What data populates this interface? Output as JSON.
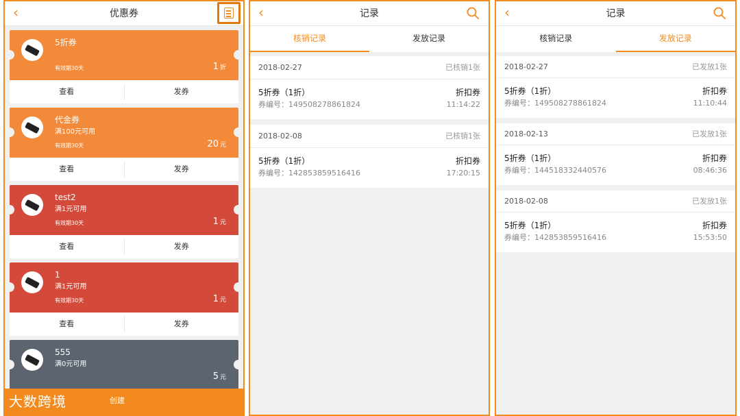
{
  "panel1": {
    "title": "优惠券",
    "back_icon": "‹",
    "coupons": [
      {
        "name": "5折券",
        "condition": "",
        "validity": "有效期30天",
        "amount": "1",
        "unit": "折",
        "color": "#f28a3a"
      },
      {
        "name": "代金券",
        "condition": "满100元可用",
        "validity": "有效期30天",
        "amount": "20",
        "unit": "元",
        "color": "#f28a3a"
      },
      {
        "name": "test2",
        "condition": "满1元可用",
        "validity": "有效期30天",
        "amount": "1",
        "unit": "元",
        "color": "#d44a3a"
      },
      {
        "name": "1",
        "condition": "满1元可用",
        "validity": "有效期30天",
        "amount": "1",
        "unit": "元",
        "color": "#d44a3a"
      },
      {
        "name": "555",
        "condition": "满0元可用",
        "validity": "",
        "amount": "5",
        "unit": "元",
        "color": "#5c6470"
      }
    ],
    "action_view": "查看",
    "action_issue": "发券",
    "brand": "大数跨境",
    "create_label": "创建"
  },
  "panel2": {
    "title": "记录",
    "tabs": [
      "核销记录",
      "发放记录"
    ],
    "active_tab": 0,
    "records": [
      {
        "date": "2018-02-27",
        "status": "已核销1张",
        "coupon_name": "5折券（1折）",
        "coupon_no": "券编号：149508278861824",
        "type": "折扣券",
        "time": "11:14:22"
      },
      {
        "date": "2018-02-08",
        "status": "已核销1张",
        "coupon_name": "5折券（1折）",
        "coupon_no": "券编号：142853859516416",
        "type": "折扣券",
        "time": "17:20:15"
      }
    ]
  },
  "panel3": {
    "title": "记录",
    "tabs": [
      "核销记录",
      "发放记录"
    ],
    "active_tab": 1,
    "records": [
      {
        "date": "2018-02-27",
        "status": "已发放1张",
        "coupon_name": "5折券（1折）",
        "coupon_no": "券编号：149508278861824",
        "type": "折扣券",
        "time": "11:10:44"
      },
      {
        "date": "2018-02-13",
        "status": "已发放1张",
        "coupon_name": "5折券（1折）",
        "coupon_no": "券编号：144518332440576",
        "type": "折扣券",
        "time": "08:46:36"
      },
      {
        "date": "2018-02-08",
        "status": "已发放1张",
        "coupon_name": "5折券（1折）",
        "coupon_no": "券编号：142853859516416",
        "type": "折扣券",
        "time": "15:53:50"
      }
    ]
  },
  "colors": {
    "accent": "#f28a1e",
    "orange": "#f28a3a",
    "red": "#d44a3a",
    "gray": "#5c6470"
  }
}
